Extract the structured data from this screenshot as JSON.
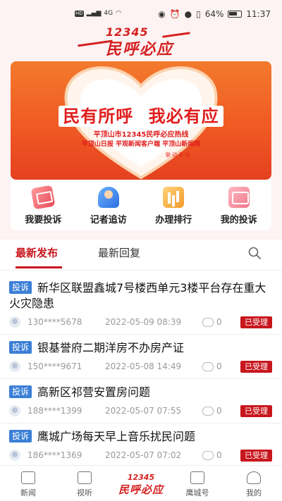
{
  "status_bar": {
    "time": "11:37",
    "battery": "64%",
    "network": "4G"
  },
  "header": {
    "brand_number": "12345",
    "brand_text": "民呼必应"
  },
  "banner": {
    "title_left": "民有所呼",
    "title_right": "我必有应",
    "line1": "平顶山市12345民呼必应热线",
    "line2": "平顶山日报  平观新闻客户端  平顶山新闻网",
    "line3": "联·动·平·台"
  },
  "quick_actions": [
    {
      "label": "我要投诉",
      "icon": "complaint-mail-icon"
    },
    {
      "label": "记者追访",
      "icon": "reporter-icon"
    },
    {
      "label": "办理排行",
      "icon": "ranking-chart-icon"
    },
    {
      "label": "我的投诉",
      "icon": "my-complaints-icon"
    }
  ],
  "tabs": [
    {
      "label": "最新发布"
    },
    {
      "label": "最新回复"
    }
  ],
  "posts": [
    {
      "badge": "投诉",
      "title": "新华区联盟鑫城7号楼西单元3楼平台存在重大火灾隐患",
      "phone": "130****5678",
      "date": "2022-05-09  08:39",
      "comments": "0",
      "status": "已受理"
    },
    {
      "badge": "投诉",
      "title": "银基誉府二期洋房不办房产证",
      "phone": "150****9671",
      "date": "2022-05-08  14:49",
      "comments": "0",
      "status": "已受理"
    },
    {
      "badge": "投诉",
      "title": "高新区祁营安置房问题",
      "phone": "188****1399",
      "date": "2022-05-07  07:55",
      "comments": "0",
      "status": "已受理"
    },
    {
      "badge": "投诉",
      "title": "鹰城广场每天早上音乐扰民问题",
      "phone": "186****1369",
      "date": "2022-05-07  07:02",
      "comments": "0",
      "status": "已受理"
    }
  ],
  "bottom_nav": {
    "news": "新闻",
    "video": "视听",
    "brand_number": "12345",
    "brand_text": "民呼必应",
    "yingcheng": "鹰城号",
    "mine": "我的"
  },
  "colors": {
    "brand_red": "#c8161d",
    "badge_blue": "#3b7fd6",
    "banner_orange": "#f05a24"
  }
}
